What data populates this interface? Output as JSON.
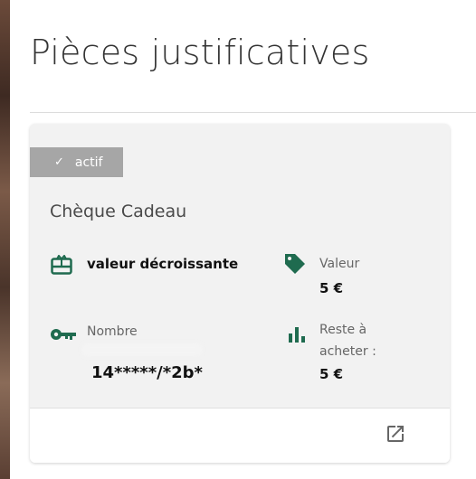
{
  "page": {
    "title": "Pièces justificatives"
  },
  "card": {
    "status": "actif",
    "title": "Chèque Cadeau",
    "type_label": "valeur décroissante",
    "value_label": "Valeur",
    "value": "5 €",
    "number_label": "Nombre",
    "number_value": "14*****/*2b*",
    "remaining_label_line1": "Reste à",
    "remaining_label_line2": "acheter :",
    "remaining_value": "5 €"
  },
  "icons": {
    "check": "check-icon",
    "gift_card": "gift-card-icon",
    "tag": "tag-icon",
    "key": "key-icon",
    "bar_chart": "bar-chart-icon",
    "open_external": "open-in-new-icon"
  },
  "colors": {
    "accent": "#1f6b4f",
    "badge": "#a6a6a6"
  }
}
